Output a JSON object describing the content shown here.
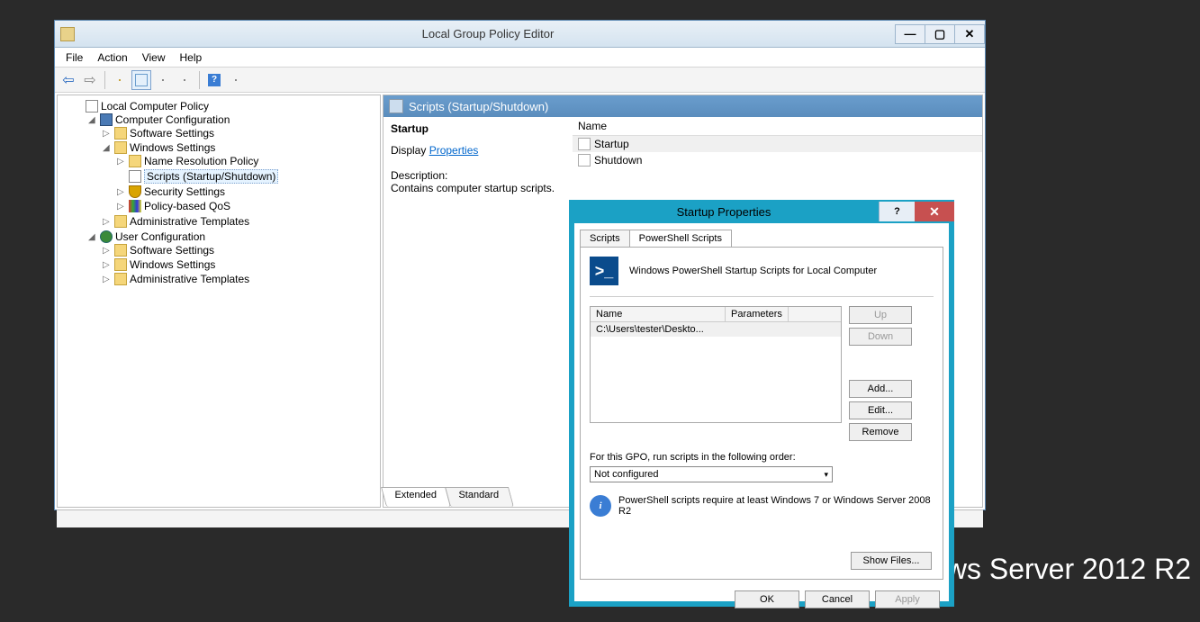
{
  "desktop_watermark": "ws Server 2012 R2",
  "window": {
    "title": "Local Group Policy Editor",
    "menu": [
      "File",
      "Action",
      "View",
      "Help"
    ]
  },
  "tree": {
    "root": "Local Computer Policy",
    "computer_config": "Computer Configuration",
    "cc_software": "Software Settings",
    "cc_windows": "Windows Settings",
    "cc_nrp": "Name Resolution Policy",
    "cc_scripts": "Scripts (Startup/Shutdown)",
    "cc_security": "Security Settings",
    "cc_qos": "Policy-based QoS",
    "cc_admin": "Administrative Templates",
    "user_config": "User Configuration",
    "uc_software": "Software Settings",
    "uc_windows": "Windows Settings",
    "uc_admin": "Administrative Templates"
  },
  "pane": {
    "header": "Scripts (Startup/Shutdown)",
    "item_name": "Startup",
    "display_label": "Display ",
    "properties_link": "Properties",
    "desc_label": "Description:",
    "desc_text": "Contains computer startup scripts.",
    "list_header": "Name",
    "list_items": [
      "Startup",
      "Shutdown"
    ],
    "tab_extended": "Extended",
    "tab_standard": "Standard"
  },
  "dialog": {
    "title": "Startup Properties",
    "tab_scripts": "Scripts",
    "tab_ps": "PowerShell Scripts",
    "ps_header": "Windows PowerShell Startup Scripts for Local Computer",
    "col_name": "Name",
    "col_params": "Parameters",
    "row1": "C:\\Users\\tester\\Deskto...",
    "btn_up": "Up",
    "btn_down": "Down",
    "btn_add": "Add...",
    "btn_edit": "Edit...",
    "btn_remove": "Remove",
    "order_label": "For this GPO, run scripts in the following order:",
    "order_value": "Not configured",
    "info_text": "PowerShell scripts require at least Windows 7 or Windows Server 2008 R2",
    "show_files": "Show Files...",
    "ok": "OK",
    "cancel": "Cancel",
    "apply": "Apply"
  }
}
